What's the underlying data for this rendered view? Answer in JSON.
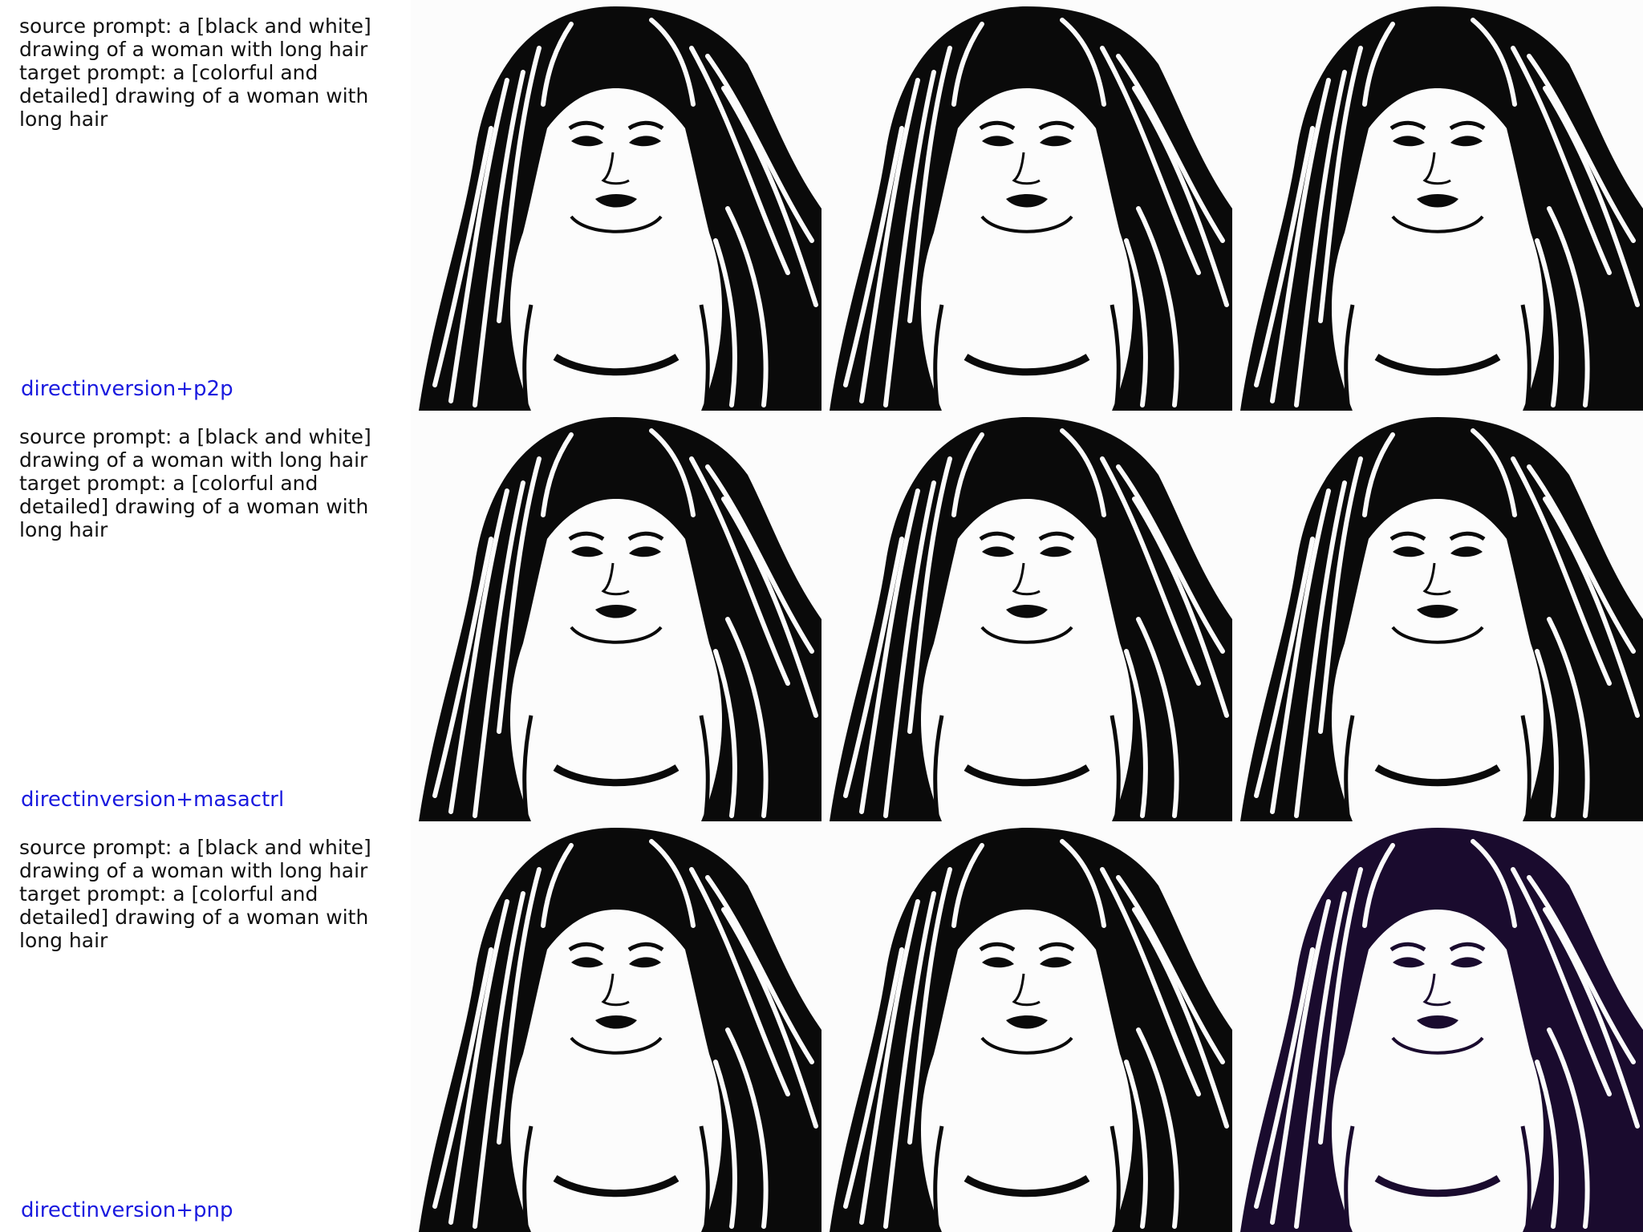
{
  "rows": [
    {
      "source_prompt": "source prompt: a [black and white] drawing of a woman with long hair",
      "target_prompt": "target prompt: a [colorful and detailed] drawing of a woman with long hair",
      "method": "directinversion+p2p"
    },
    {
      "source_prompt": "source prompt: a [black and white] drawing of a woman with long hair",
      "target_prompt": "target prompt: a [colorful and detailed] drawing of a woman with long hair",
      "method": "directinversion+masactrl"
    },
    {
      "source_prompt": "source prompt: a [black and white] drawing of a woman with long hair",
      "target_prompt": "target prompt: a [colorful and detailed] drawing of a woman with long hair",
      "method": "directinversion+pnp"
    }
  ],
  "colors": {
    "method_label": "#1a1adf",
    "ink": "#0a0a0a",
    "ink_purple": "#1a0b2e"
  }
}
